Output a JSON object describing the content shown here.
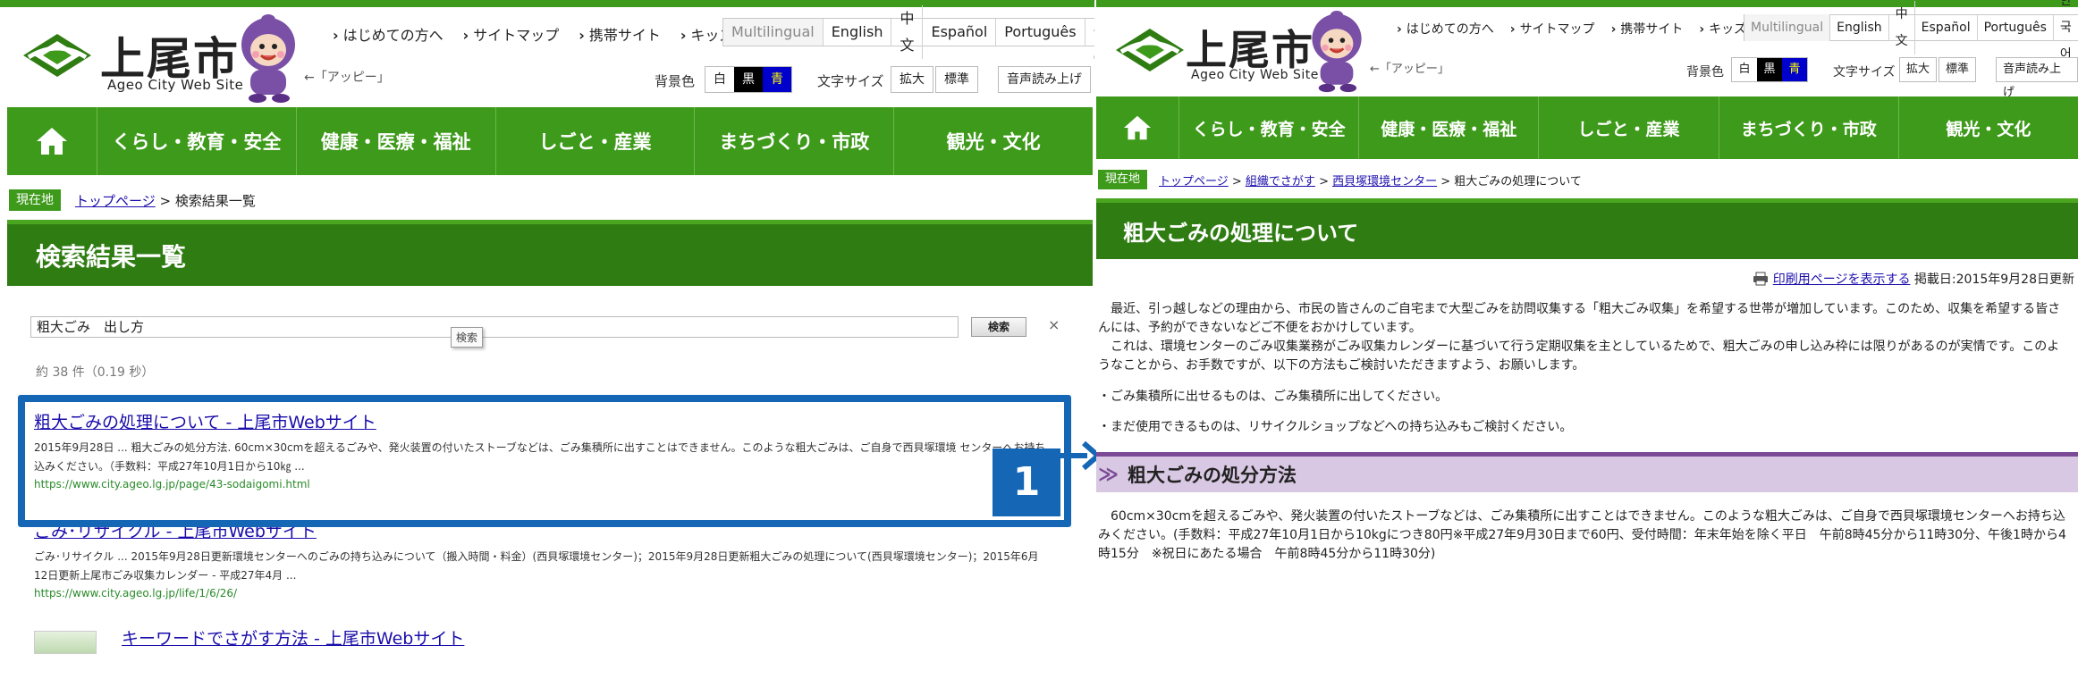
{
  "site": {
    "title": "上尾市",
    "subtitle": "Ageo City Web Site",
    "mascot_caption": "←「アッピー」",
    "quick_links": [
      "はじめての方へ",
      "サイトマップ",
      "携帯サイト",
      "キッズサイト"
    ],
    "languages": [
      "Multilingual",
      "English",
      "中文",
      "Español",
      "Português",
      "한국어"
    ],
    "bg_color_label": "背景色",
    "bg_options": [
      "白",
      "黒",
      "青"
    ],
    "text_size_label": "文字サイズ",
    "text_size_options": [
      "拡大",
      "標準"
    ],
    "read_aloud": "音声読み上げ",
    "nav": [
      "くらし・教育・安全",
      "健康・医療・福祉",
      "しごと・産業",
      "まちづくり・市政",
      "観光・文化"
    ]
  },
  "left": {
    "crumb_badge": "現在地",
    "crumb_home": "トップページ",
    "crumb_sep": " > ",
    "crumb_current": "検索結果一覧",
    "page_title": "検索結果一覧",
    "search_value": "粗大ごみ　出し方",
    "search_button": "検索",
    "close": "×",
    "tooltip": "検索",
    "result_count": "約 38 件（0.19 秒）",
    "results": [
      {
        "title": "粗大ごみの処理について - 上尾市Webサイト",
        "snippet1": "2015年9月28日 ... 粗大ごみの処分方法. 60cm×30cmを超えるごみや、発火装置の付いたストーブなどは、ごみ集積所に出すことはできません。このような粗大ごみは、ご自身で西貝塚環境 センターへお持ち",
        "snippet2": "込みください。（手数料：平成27年10月1日から10㎏ ...",
        "url": "https://www.city.ageo.lg.jp/page/43-sodaigomi.html"
      },
      {
        "title": "ごみ･リサイクル - 上尾市Webサイト",
        "snippet1": "ごみ･リサイクル ... 2015年9月28日更新環境センターへのごみの持ち込みについて（搬入時間・料金）(西貝塚環境センター)；2015年9月28日更新粗大ごみの処理について(西貝塚環境センター)；2015年6月",
        "snippet2": "12日更新上尾市ごみ収集カレンダー - 平成27年4月 ...",
        "url": "https://www.city.ageo.lg.jp/life/1/6/26/"
      },
      {
        "title": "キーワードでさがす方法 - 上尾市Webサイト"
      }
    ],
    "highlight_number": "1"
  },
  "right": {
    "crumb_badge": "現在地",
    "crumbs": [
      "トップページ",
      "組織でさがす",
      "西貝塚環境センター"
    ],
    "crumb_sep": " > ",
    "crumb_current": "粗大ごみの処理について",
    "page_title": "粗大ごみの処理について",
    "print_link": "印刷用ページを表示する",
    "posted_date": "掲載日:2015年9月28日更新",
    "para1": "　最近、引っ越しなどの理由から、市民の皆さんのご自宅まで大型ごみを訪問収集する「粗大ごみ収集」を希望する世帯が増加しています。このため、収集を希望する皆さんには、予約ができないなどご不便をおかけしています。",
    "para2": "　これは、環境センターのごみ収集業務がごみ収集カレンダーに基づいて行う定期収集を主としているためで、粗大ごみの申し込み枠には限りがあるのが実情です。このようなことから、お手数ですが、以下の方法もご検討いただきますよう、お願いします。",
    "bullet1": "・ごみ集積所に出せるものは、ごみ集積所に出してください。",
    "bullet2": "・まだ使用できるものは、リサイクルショップなどへの持ち込みもご検討ください。",
    "section_title": "粗大ごみの処分方法",
    "section_text": "　60cm×30cmを超えるごみや、発火装置の付いたストーブなどは、ごみ集積所に出すことはできません。このような粗大ごみは、ご自身で西貝塚環境センターへお持ち込みください。(手数料：平成27年10月1日から10kgにつき80円※平成27年9月30日まで60円、受付時間：年末年始を除く平日　午前8時45分から11時30分、午後1時から4時15分　※祝日にあたる場合　午前8時45分から11時30分)"
  },
  "colors": {
    "green": "#3e9a1a",
    "dark_green": "#2f7d12",
    "highlight_blue": "#1566b5",
    "section_purple": "#d9c8e3"
  }
}
